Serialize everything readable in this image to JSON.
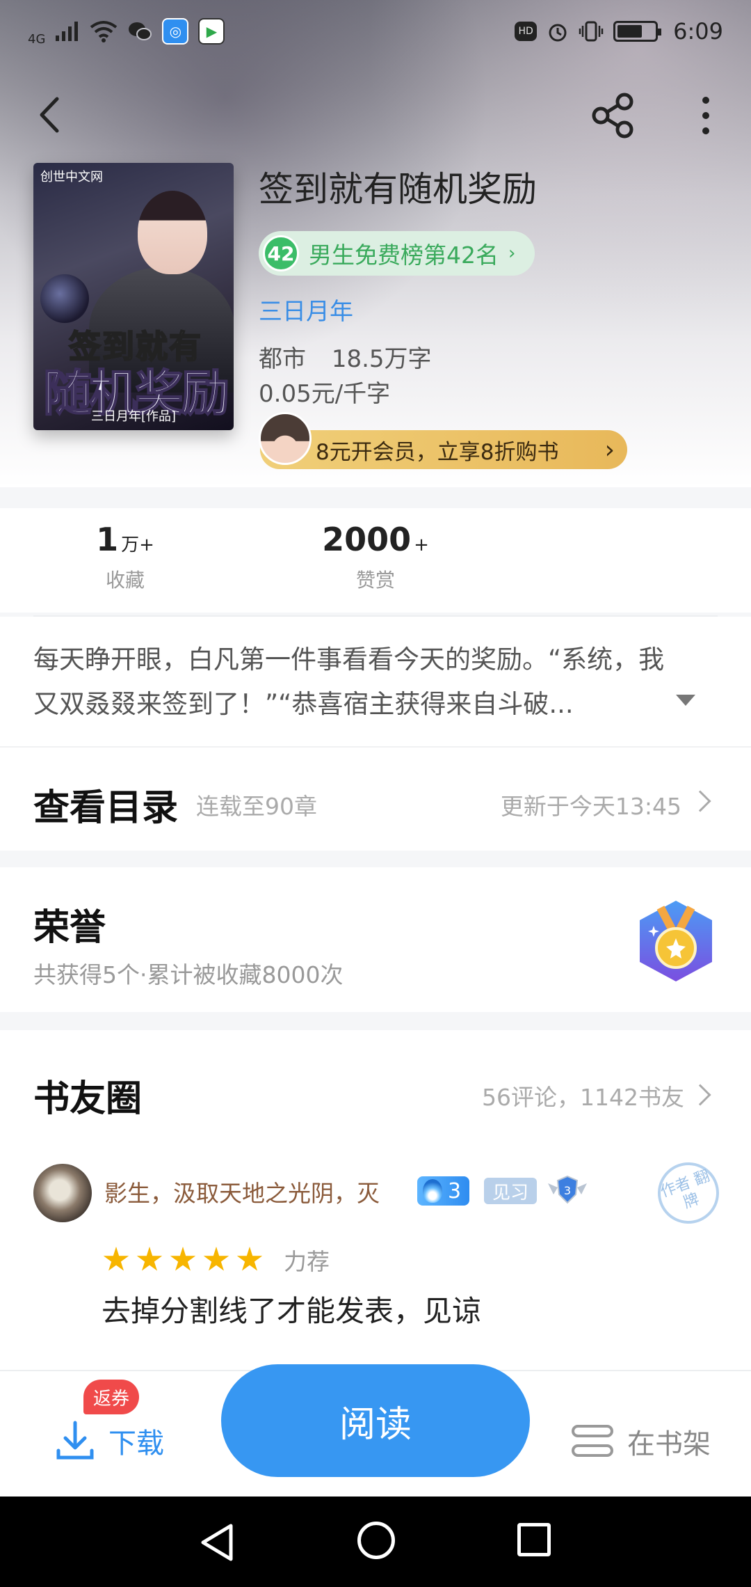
{
  "status_bar": {
    "network": "4G",
    "time": "6:09",
    "hd": "HD"
  },
  "book": {
    "title": "签到就有随机奖励",
    "rank_number": "42",
    "rank_label": "男生免费榜第42名",
    "author": "三日月年",
    "category": "都市",
    "word_count": "18.5万字",
    "price": "0.05元/千字",
    "cover": {
      "brand": "创世中文网",
      "title_line1": "签到就有",
      "title_line2": "随机奖励",
      "byline": "三日月年[作品]"
    }
  },
  "vip_banner": {
    "text": "8元开会员，立享8折购书"
  },
  "stats": {
    "favorites_value": "1",
    "favorites_unit": "万+",
    "favorites_label": "收藏",
    "tips_value": "2000",
    "tips_unit": "+",
    "tips_label": "赞赏"
  },
  "intro": {
    "text": "每天睁开眼，白凡第一件事看看今天的奖励。“系统，我又双叒叕来签到了！”“恭喜宿主获得来自斗破..."
  },
  "catalog": {
    "title": "查看目录",
    "progress": "连载至90章",
    "updated": "更新于今天13:45"
  },
  "honor": {
    "title": "荣誉",
    "summary": "共获得5个·累计被收藏8000次"
  },
  "book_circle": {
    "title": "书友圈",
    "stats": "56评论，1142书友",
    "comment": {
      "user": "影生，汲取天地之光阴，灭",
      "level": "3",
      "tag": "见习",
      "shield_level": "3",
      "stamp": "作者 翻牌",
      "rating": 5,
      "rating_label": "力荐",
      "content": "去掉分割线了才能发表，见谅"
    }
  },
  "bottom_bar": {
    "coupon": "返券",
    "download": "下载",
    "read": "阅读",
    "shelf": "在书架"
  },
  "colors": {
    "accent_blue": "#3797f2",
    "rank_green": "#3bbd68",
    "vip_gold": "#e8b85a",
    "star": "#f7b500",
    "coupon_red": "#f04a4a"
  }
}
